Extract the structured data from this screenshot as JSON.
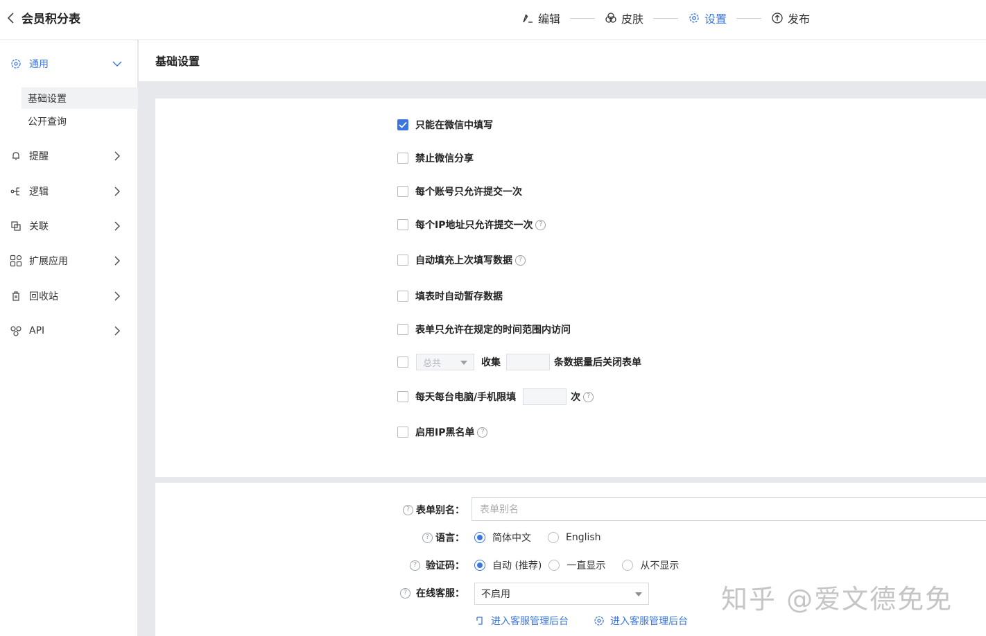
{
  "header": {
    "title": "会员积分表",
    "steps": [
      {
        "label": "编辑",
        "icon": "edit-icon"
      },
      {
        "label": "皮肤",
        "icon": "skin-icon"
      },
      {
        "label": "设置",
        "icon": "gear-icon"
      },
      {
        "label": "发布",
        "icon": "publish-icon"
      }
    ],
    "active_step": "设置"
  },
  "sidebar": {
    "general": {
      "label": "通用",
      "sub": [
        "基础设置",
        "公开查询"
      ]
    },
    "items": [
      {
        "label": "提醒",
        "icon": "bell-icon"
      },
      {
        "label": "逻辑",
        "icon": "logic-icon"
      },
      {
        "label": "关联",
        "icon": "link-icon"
      },
      {
        "label": "扩展应用",
        "icon": "apps-icon"
      },
      {
        "label": "回收站",
        "icon": "recycle-icon"
      },
      {
        "label": "API",
        "icon": "api-icon"
      }
    ]
  },
  "main": {
    "title": "基础设置",
    "options": {
      "wechat_only": {
        "label": "只能在微信中填写",
        "checked": true
      },
      "no_share": {
        "label": "禁止微信分享",
        "checked": false
      },
      "one_per_account": {
        "label": "每个账号只允许提交一次",
        "checked": false
      },
      "one_per_ip": {
        "label": "每个IP地址只允许提交一次",
        "checked": false
      },
      "autofill": {
        "label": "自动填充上次填写数据",
        "checked": false
      },
      "autosave": {
        "label": "填表时自动暂存数据",
        "checked": false
      },
      "time_range": {
        "label": "表单只允许在规定的时间范围内访问",
        "checked": false
      },
      "limit_total": {
        "select": "总共",
        "prefix": "收集",
        "suffix": "条数据量后关闭表单",
        "checked": false
      },
      "daily_limit": {
        "label": "每天每台电脑/手机限填",
        "suffix": "次",
        "checked": false
      },
      "ip_blacklist": {
        "label": "启用IP黑名单",
        "checked": false
      }
    },
    "form": {
      "alias_label": "表单别名：",
      "alias_placeholder": "表单别名",
      "lang_label": "语言：",
      "lang_options": [
        "简体中文",
        "English"
      ],
      "lang_selected": "简体中文",
      "captcha_label": "验证码：",
      "captcha_options": [
        "自动 (推荐)",
        "一直显示",
        "从不显示"
      ],
      "captcha_selected": "自动 (推荐)",
      "service_label": "在线客服：",
      "service_value": "不启用",
      "links": [
        "进入客服管理后台",
        "进入客服管理后台"
      ]
    }
  },
  "watermark": "知乎 @爱文德免免",
  "colors": {
    "accent": "#3a75e0"
  }
}
